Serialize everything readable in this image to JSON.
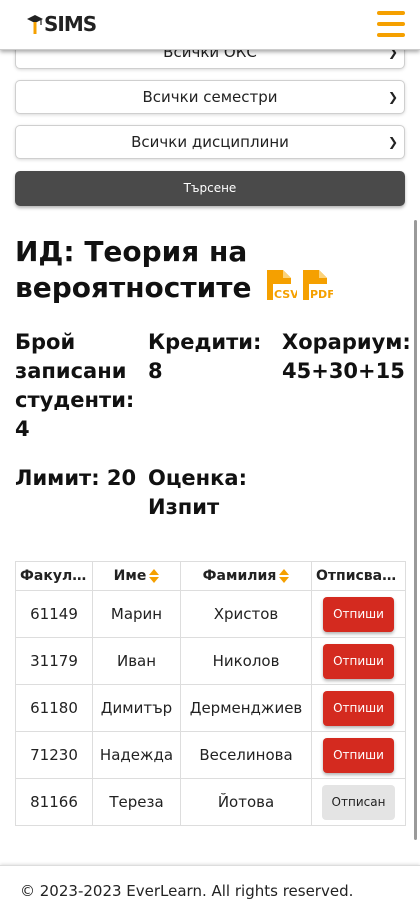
{
  "brand": {
    "logo_text": "SIMS",
    "accent": "#f5a000"
  },
  "nav": {
    "menu_icon": "hamburger-icon"
  },
  "filters": {
    "oks": "Всички ОКС",
    "semester": "Всички семестри",
    "discipline": "Всички дисциплини"
  },
  "search_button": "Търсене",
  "course": {
    "title": "ИД: Теория на вероятностите",
    "export_icons": [
      "csv-file-icon",
      "pdf-file-icon"
    ],
    "enrolled_label": "Брой записани студенти:",
    "enrolled_value": "4",
    "credits_label": "Кредити:",
    "credits_value": "8",
    "hours_label": "Хорариум:",
    "hours_value": "45+30+15",
    "limit_label": "Лимит:",
    "limit_value": "20",
    "grading_label": "Оценка:",
    "grading_value": "Изпит"
  },
  "table": {
    "headers": {
      "faculty_no": "Факултетен номер",
      "first_name": "Име",
      "last_name": "Фамилия",
      "unsubscribe": "Отписване"
    },
    "rows": [
      {
        "faculty_no": "61149",
        "first_name": "Марин",
        "last_name": "Христов",
        "action": "Отпиши",
        "done": false
      },
      {
        "faculty_no": "31179",
        "first_name": "Иван",
        "last_name": "Николов",
        "action": "Отпиши",
        "done": false
      },
      {
        "faculty_no": "61180",
        "first_name": "Димитър",
        "last_name": "Дерменджиев",
        "action": "Отпиши",
        "done": false
      },
      {
        "faculty_no": "71230",
        "first_name": "Надежда",
        "last_name": "Веселинова",
        "action": "Отпиши",
        "done": false
      },
      {
        "faculty_no": "81166",
        "first_name": "Тереза",
        "last_name": "Йотова",
        "action": "Отписан",
        "done": true
      }
    ]
  },
  "footer": {
    "text": "© 2023-2023 EverLearn. All rights reserved."
  },
  "colors": {
    "danger": "#d42a1f",
    "dark_button": "#4a4a4a",
    "muted_button": "#e4e4e4"
  }
}
